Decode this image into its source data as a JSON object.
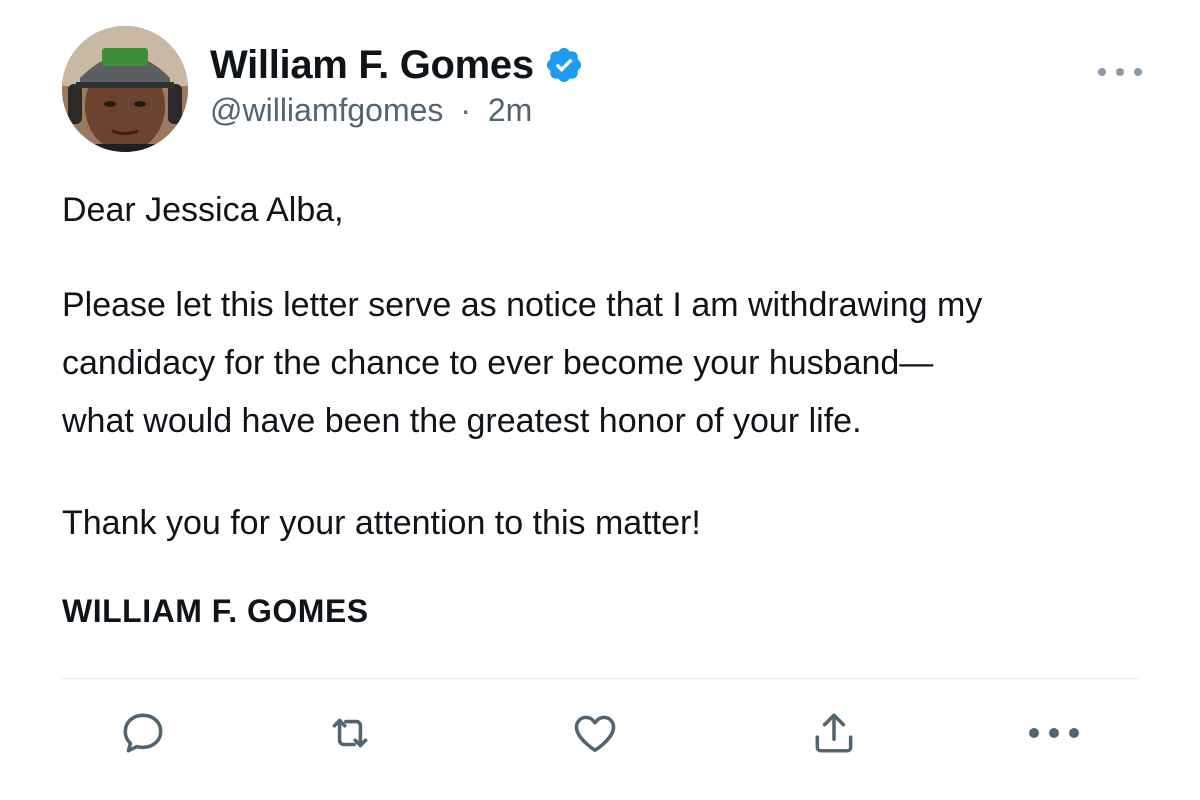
{
  "tweet": {
    "author": {
      "display_name": "William F. Gomes",
      "handle": "@williamfgomes",
      "separator": "·",
      "time": "2m",
      "verified": true,
      "avatar": "profile-photo"
    },
    "body": {
      "greeting": "Dear Jessica Alba,",
      "paragraph_lines": [
        "Please let this letter serve as notice that I am withdrawing my",
        "candidacy for the chance to ever become your husband—",
        "what would have been the greatest honor of your life."
      ],
      "closing": "Thank you for your attention to this matter!",
      "signature": "WILLIAM F. GOMES"
    },
    "actions": [
      {
        "name": "reply",
        "icon": "speech-bubble-icon"
      },
      {
        "name": "retweet",
        "icon": "retweet-arrows-icon"
      },
      {
        "name": "like",
        "icon": "heart-icon"
      },
      {
        "name": "share",
        "icon": "share-upload-icon"
      },
      {
        "name": "more",
        "icon": "more-dots-icon"
      }
    ]
  },
  "colors": {
    "text_primary": "#0f1419",
    "text_secondary": "#536471",
    "verified_blue": "#1d9bf0",
    "divider": "#e7e9ea"
  }
}
